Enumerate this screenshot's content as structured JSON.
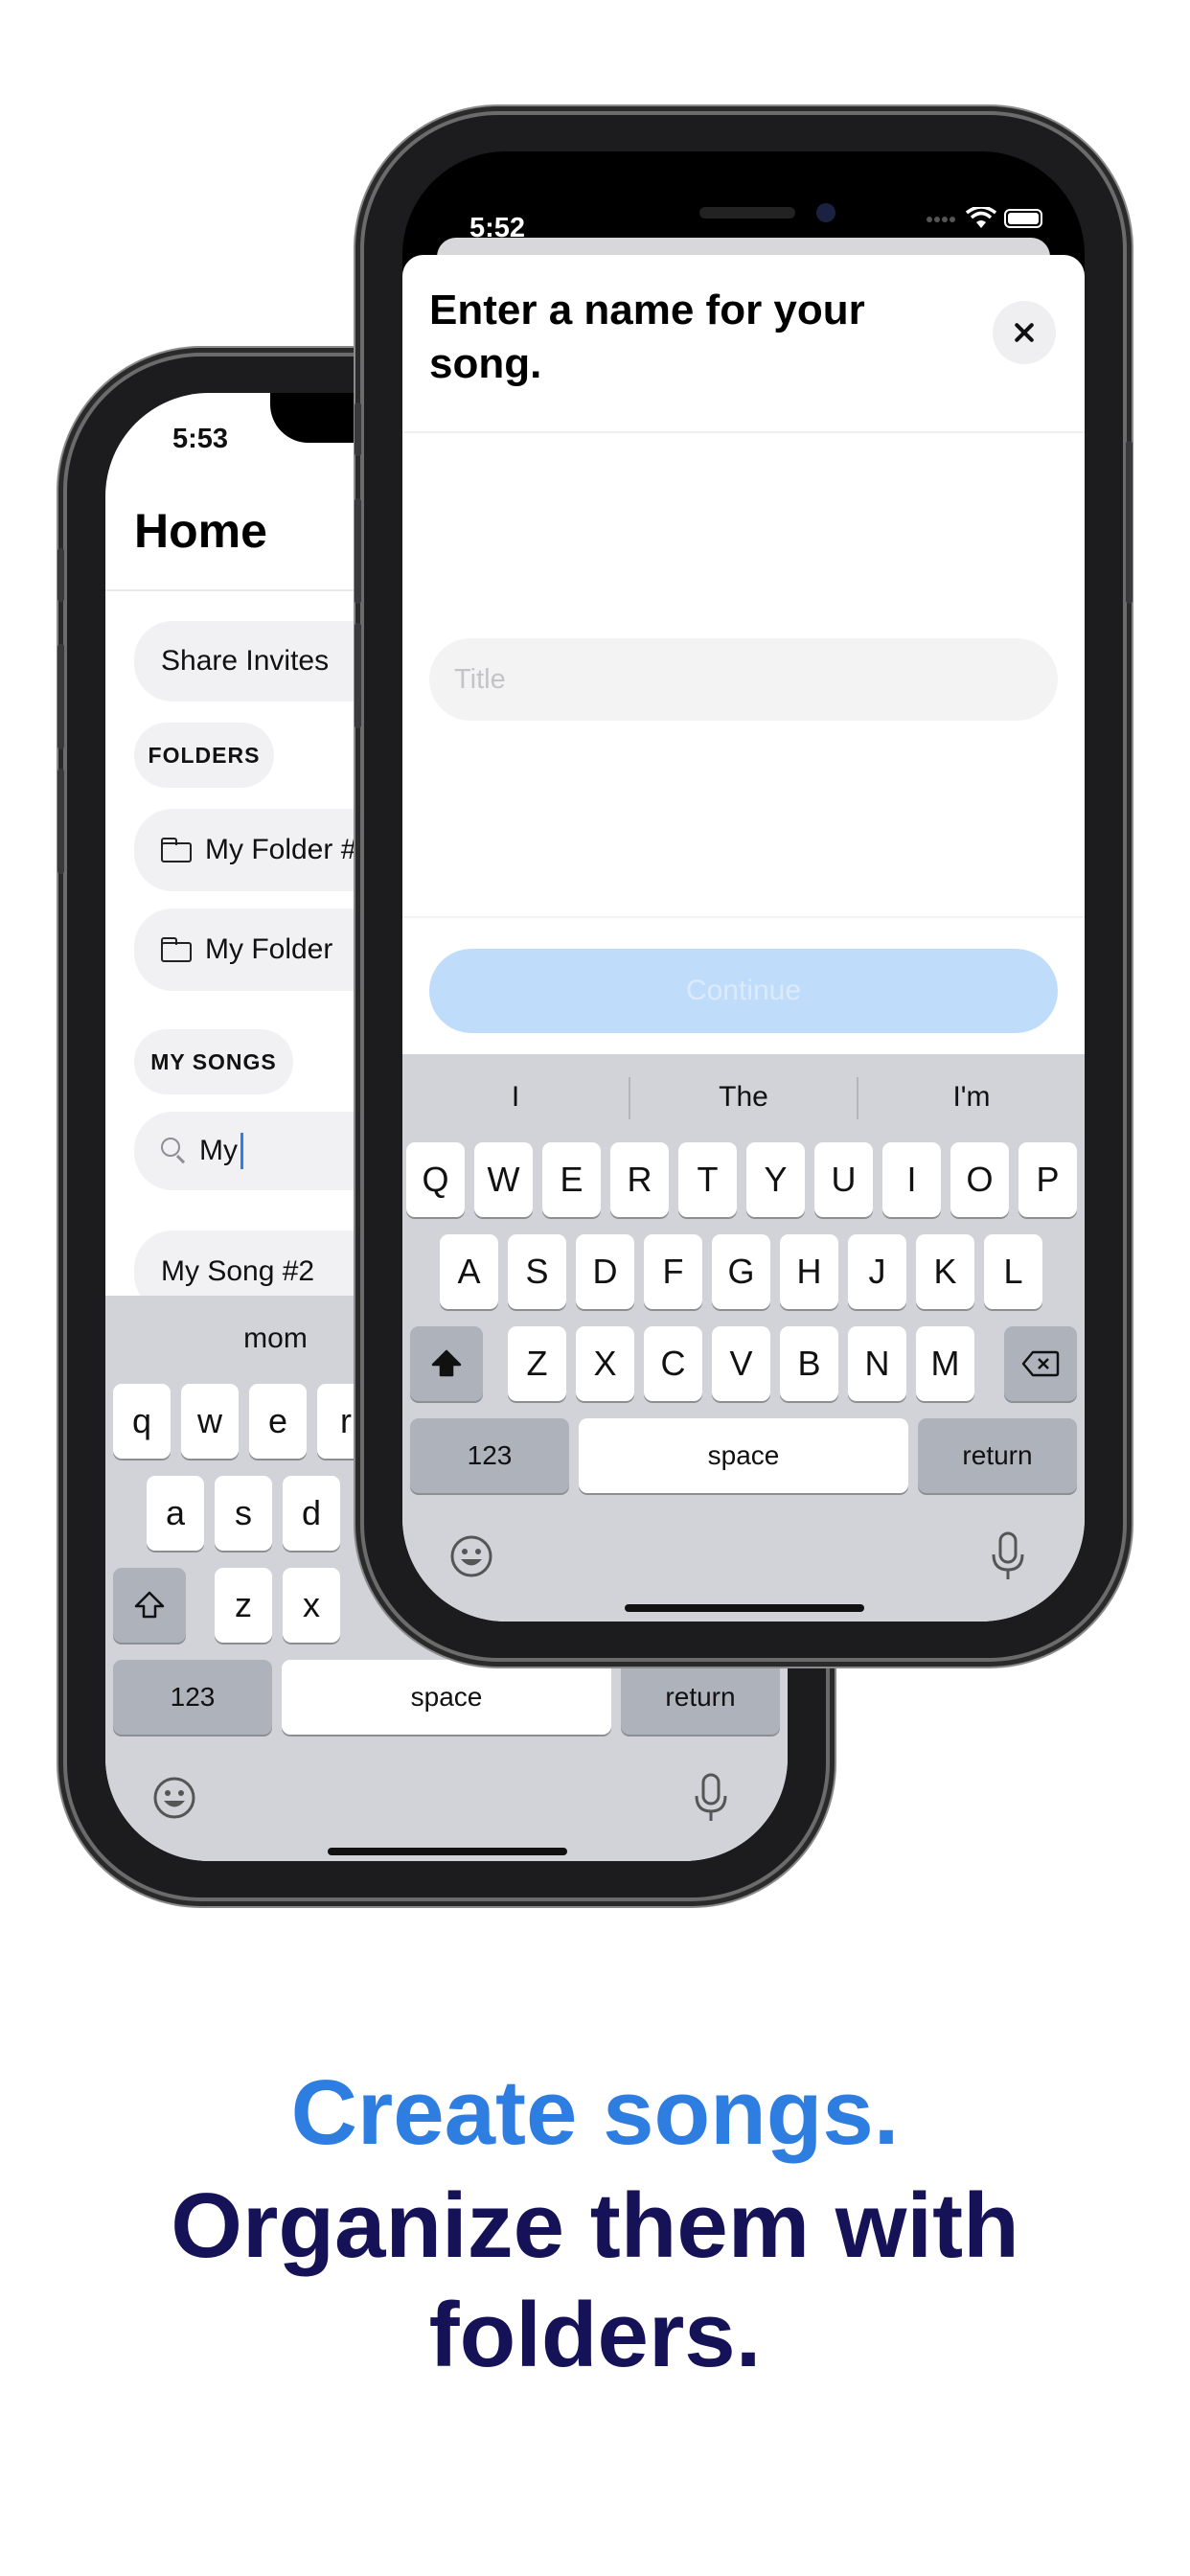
{
  "back_phone": {
    "time": "5:53",
    "title": "Home",
    "share_invites": "Share Invites",
    "folders_header": "FOLDERS",
    "folders": [
      "My Folder #2",
      "My Folder"
    ],
    "songs_header": "MY SONGS",
    "search_value": "My",
    "songs": [
      "My Song #2"
    ],
    "keyboard": {
      "suggestions": [
        "mom",
        ""
      ],
      "row1": [
        "q",
        "w",
        "e",
        "r"
      ],
      "row2": [
        "a",
        "s",
        "d"
      ],
      "row3": [
        "z",
        "x"
      ],
      "numbers": "123",
      "space": "space",
      "return": "return"
    }
  },
  "front_phone": {
    "time": "5:52",
    "sheet_title": "Enter a name for your song.",
    "title_placeholder": "Title",
    "continue_label": "Continue",
    "keyboard": {
      "suggestions": [
        "I",
        "The",
        "I'm"
      ],
      "row1": [
        "Q",
        "W",
        "E",
        "R",
        "T",
        "Y",
        "U",
        "I",
        "O",
        "P"
      ],
      "row2": [
        "A",
        "S",
        "D",
        "F",
        "G",
        "H",
        "J",
        "K",
        "L"
      ],
      "row3": [
        "Z",
        "X",
        "C",
        "V",
        "B",
        "N",
        "M"
      ],
      "numbers": "123",
      "space": "space",
      "return": "return"
    }
  },
  "headline": {
    "line1": "Create songs.",
    "line2": "Organize them with folders."
  },
  "colors": {
    "accent_blue": "#2e7de0",
    "navy": "#161257",
    "continue_disabled": "#c0dcfb"
  }
}
